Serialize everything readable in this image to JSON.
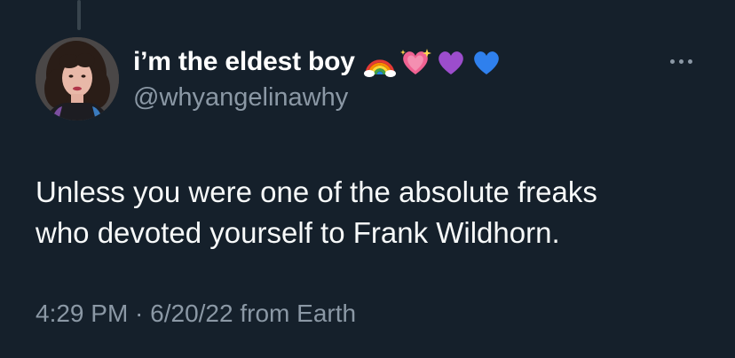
{
  "tweet": {
    "display_name": "i’m the eldest boy",
    "name_emojis": [
      "rainbow-icon",
      "sparkling-heart-icon",
      "purple-heart-icon",
      "blue-heart-icon"
    ],
    "handle": "@whyangelinawhy",
    "text_lines": [
      "Unless you were one of the absolute freaks",
      "who devoted yourself to Frank Wildhorn."
    ],
    "timestamp": "4:29 PM · 6/20/22 from Earth"
  },
  "colors": {
    "background": "#15202b",
    "primary_text": "#f7f9f9",
    "secondary_text": "#8b98a5",
    "thread_line": "#38444d"
  }
}
